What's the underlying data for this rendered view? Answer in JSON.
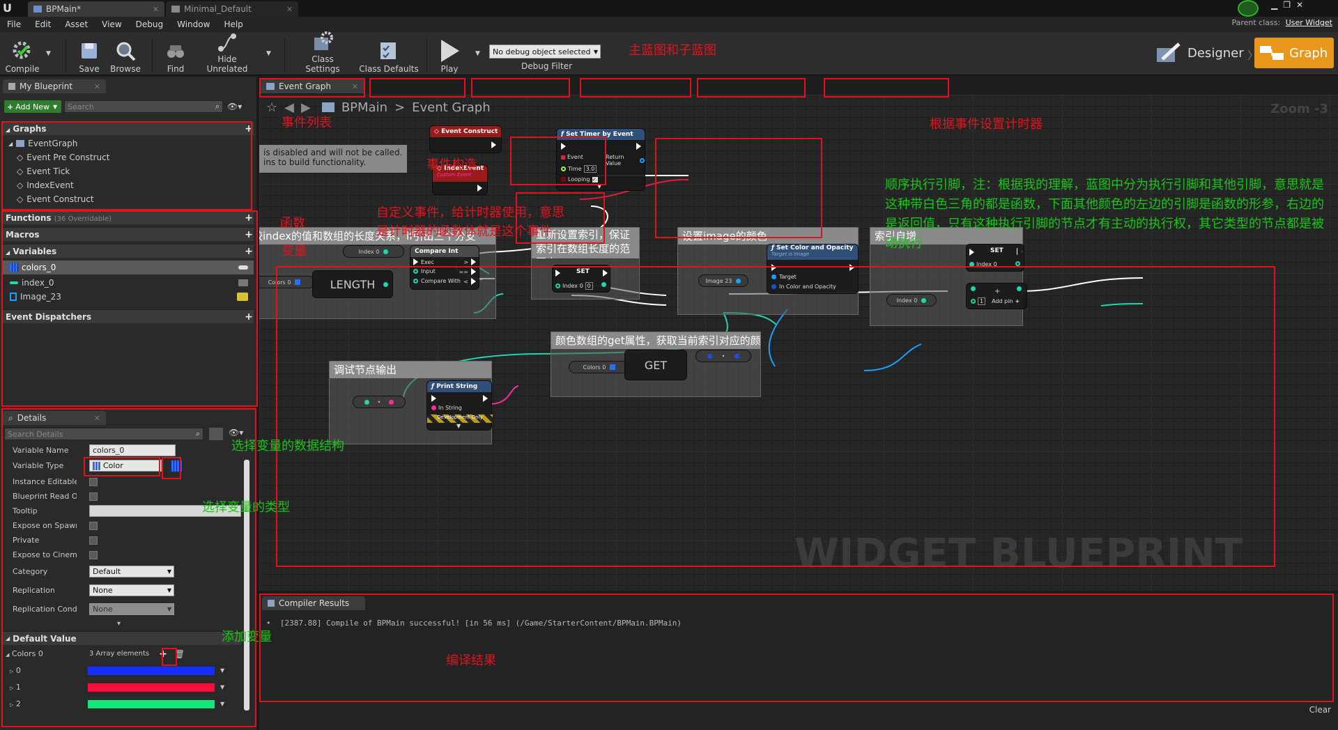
{
  "window": {
    "tabs": [
      {
        "label": "BPMain*"
      },
      {
        "label": "Minimal_Default"
      }
    ],
    "parent_class_label": "Parent class:",
    "parent_class_value": "User Widget"
  },
  "menu": [
    "File",
    "Edit",
    "Asset",
    "View",
    "Debug",
    "Window",
    "Help"
  ],
  "toolbar": {
    "compile": "Compile",
    "save": "Save",
    "browse": "Browse",
    "find": "Find",
    "hide_unrelated": "Hide Unrelated",
    "class_settings": "Class Settings",
    "class_defaults": "Class Defaults",
    "play": "Play",
    "debug_select": "No debug object selected",
    "debug_filter": "Debug Filter",
    "designer": "Designer",
    "graph": "Graph"
  },
  "my_blueprint": {
    "tab": "My Blueprint",
    "add_new": "Add New",
    "search_placeholder": "Search",
    "graphs_header": "Graphs",
    "event_graph": "EventGraph",
    "events": [
      "Event Pre Construct",
      "Event Tick",
      "IndexEvent",
      "Event Construct"
    ],
    "functions_header": "Functions",
    "functions_overridable": "(36 Overridable)",
    "macros_header": "Macros",
    "variables_header": "Variables",
    "variables": [
      {
        "name": "colors_0",
        "color": "#2a6cff"
      },
      {
        "name": "index_0",
        "color": "#1fd6b0"
      },
      {
        "name": "Image_23",
        "color": "#1aa0ff"
      }
    ],
    "event_dispatchers_header": "Event Dispatchers"
  },
  "details": {
    "tab": "Details",
    "search_placeholder": "Search Details",
    "rows": {
      "variable_name_label": "Variable Name",
      "variable_name_value": "colors_0",
      "variable_type_label": "Variable Type",
      "variable_type_value": "Color",
      "instance_editable": "Instance Editable",
      "bp_read_only": "Blueprint Read Only",
      "tooltip": "Tooltip",
      "expose_spawn": "Expose on Spawn",
      "private": "Private",
      "expose_cinematic": "Expose to Cinematic",
      "category_label": "Category",
      "category_value": "Default",
      "replication_label": "Replication",
      "replication_value": "None",
      "replication_cond_label": "Replication Conditio",
      "replication_cond_value": "None"
    },
    "default_value_header": "Default Value",
    "array_label": "Colors 0",
    "array_count": "3 Array elements",
    "array_items": [
      {
        "index": "0",
        "color": "#1430ff"
      },
      {
        "index": "1",
        "color": "#ff0a3c"
      },
      {
        "index": "2",
        "color": "#14e67a"
      }
    ]
  },
  "graph_tabs": {
    "event_graph": "Event Graph"
  },
  "breadcrumb": {
    "root": "BPMain",
    "separator": ">",
    "current": "Event Graph"
  },
  "zoom": "Zoom -3",
  "disabled_note": {
    "line1": "is disabled and will not be called.",
    "line2": "ins to build functionality."
  },
  "nodes": {
    "event_construct": "Event Construct",
    "index_event": "IndexEvent",
    "index_event_sub": "Custom Event",
    "set_timer": "Set Timer by Event",
    "set_timer_event": "Event",
    "set_timer_return": "Return Value",
    "set_timer_time": "Time",
    "set_timer_time_val": "3.0",
    "set_timer_looping": "Looping",
    "compare_int": "Compare Int",
    "compare_exec": "Exec",
    "compare_input": "Input",
    "compare_with": "Compare With",
    "compare_gt": ">",
    "compare_eq": "==",
    "compare_lt": "<",
    "length": "LENGTH",
    "set": "SET",
    "index_var": "Index 0",
    "colors_var": "Colors 0",
    "image_var": "Image 23",
    "set_color": "Set Color and Opacity",
    "set_color_sub": "Target is Image",
    "set_color_target": "Target",
    "set_color_in": "In Color and Opacity",
    "get": "GET",
    "print_string": "Print String",
    "print_in": "In String",
    "dev_only": "Development Only",
    "add_pin": "Add pin",
    "plus": "+",
    "one_const": "1",
    "zero_const": "0"
  },
  "comments": {
    "compare": "比较index的值和数组的长度关系，if引出三个分支",
    "reset": "重新设置索引，保证索引在数组长度的范围内",
    "image_color": "设置image的颜色",
    "increment": "索引自增",
    "get_color": "颜色数组的get属性，获取当前索引对应的颜色",
    "debug": "调试节点输出"
  },
  "watermark": "WIDGET BLUEPRINT",
  "compiler": {
    "tab": "Compiler Results",
    "log": "[2387.88] Compile of BPMain successful! [in 56 ms] (/Game/StarterContent/BPMain.BPMain)",
    "clear": "Clear"
  },
  "annotations": {
    "main_sub": "主蓝图和子蓝图",
    "event_list": "事件列表",
    "event_construct": "事件构造",
    "timer_by_event": "根据事件设置计时器",
    "custom_event": "自定义事件，给计时器使用，意思是计时器的函数体就是这个事件",
    "functions": "函数",
    "variables": "变量",
    "exec_pin_note": "顺序执行引脚，注：根据我的理解，蓝图中分为执行引脚和其他引脚，意思就是这种带白色三角的都是函数，下面其他颜色的左边的引脚是函数的形参，右边的是返回值，只有这种执行引脚的节点才有主动的执行权，其它类型的节点都是被动执行",
    "select_structure": "选择变量的数据结构",
    "select_type": "选择变量的类型",
    "add_var": "添加变量",
    "compile_result": "编译结果"
  }
}
